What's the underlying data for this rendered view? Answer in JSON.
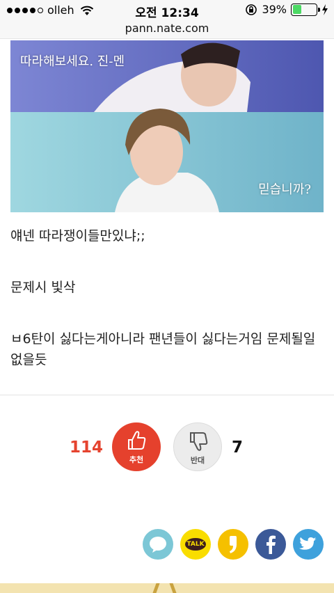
{
  "status_bar": {
    "carrier": "olleh",
    "time": "오전 12:34",
    "battery_percent": "39%",
    "battery_level": 0.39
  },
  "browser": {
    "url": "pann.nate.com"
  },
  "image": {
    "caption_top": "따라해보세요. 진-멘",
    "caption_bottom": "믿습니까?"
  },
  "post": {
    "line1": "얘넨 따라쟁이들만있냐;;",
    "line2": "문제시 빛삭",
    "line3": "ㅂ6탄이 싫다는게아니라 팬년들이 싫다는거임 문제될일 없을듯"
  },
  "votes": {
    "up_count": "114",
    "up_label": "추천",
    "down_label": "반대",
    "down_count": "7"
  },
  "share": {
    "kakao_talk_label": "TALK"
  },
  "colors": {
    "upvote": "#e5412d",
    "kakaotalk": "#f9dd00",
    "facebook": "#3b5998",
    "twitter": "#3ea1dc"
  }
}
